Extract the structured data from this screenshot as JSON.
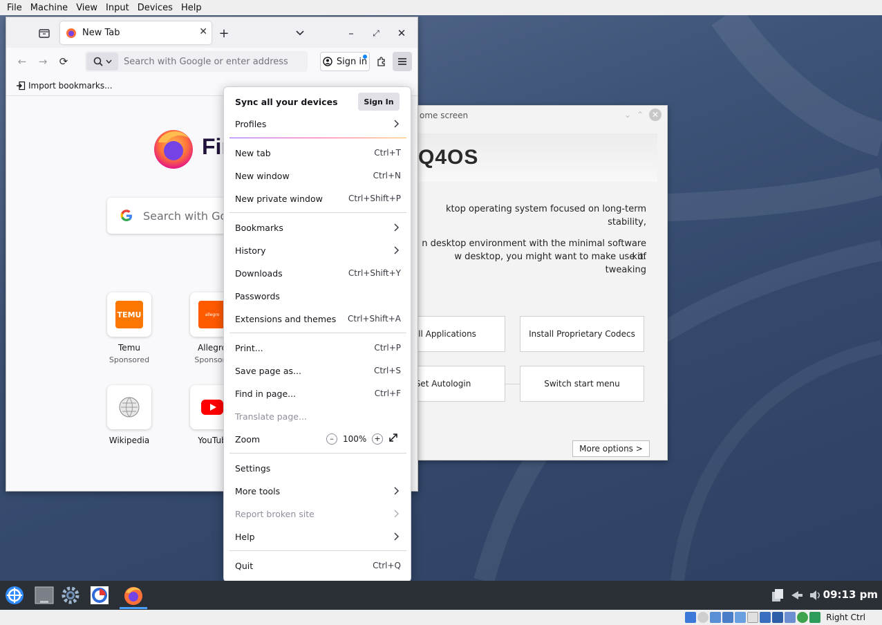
{
  "host_menu": [
    "File",
    "Machine",
    "View",
    "Input",
    "Devices",
    "Help"
  ],
  "firefox": {
    "tab_title": "New Tab",
    "url_placeholder": "Search with Google or enter address",
    "sign_in": "Sign in",
    "import_bookmarks": "Import bookmarks...",
    "wordmark": "Fir",
    "search_placeholder": "Search with Goog",
    "shortcuts": [
      {
        "label": "Temu",
        "sub": "Sponsored",
        "tile_text": "TEMU"
      },
      {
        "label": "Allegro",
        "sub": "Sponsore",
        "tile_text": "allegro"
      },
      {
        "label": "Wikipedia",
        "sub": ""
      },
      {
        "label": "YouTub",
        "sub": ""
      }
    ]
  },
  "app_menu": {
    "sync_title": "Sync all your devices",
    "sync_button": "Sign In",
    "profiles": "Profiles",
    "items": [
      {
        "label": "New tab",
        "shortcut": "Ctrl+T"
      },
      {
        "label": "New window",
        "shortcut": "Ctrl+N"
      },
      {
        "label": "New private window",
        "shortcut": "Ctrl+Shift+P"
      },
      {
        "label": "Bookmarks",
        "shortcut": ""
      },
      {
        "label": "History",
        "shortcut": ""
      },
      {
        "label": "Downloads",
        "shortcut": "Ctrl+Shift+Y"
      },
      {
        "label": "Passwords",
        "shortcut": ""
      },
      {
        "label": "Extensions and themes",
        "shortcut": "Ctrl+Shift+A"
      },
      {
        "label": "Print...",
        "shortcut": "Ctrl+P"
      },
      {
        "label": "Save page as...",
        "shortcut": "Ctrl+S"
      },
      {
        "label": "Find in page...",
        "shortcut": "Ctrl+F"
      },
      {
        "label": "Translate page...",
        "shortcut": ""
      },
      {
        "label": "Zoom",
        "shortcut": ""
      },
      {
        "label": "Settings",
        "shortcut": ""
      },
      {
        "label": "More tools",
        "shortcut": ""
      },
      {
        "label": "Report broken site",
        "shortcut": ""
      },
      {
        "label": "Help",
        "shortcut": ""
      },
      {
        "label": "Quit",
        "shortcut": "Ctrl+Q"
      }
    ],
    "zoom_value": "100%"
  },
  "welcome": {
    "title": "ome screen",
    "brand": "Q4OS",
    "text1": "ktop operating system focused on long-term stability,",
    "text2": "n desktop environment with the minimal software kit.",
    "text3": "w desktop, you might want to make use of tweaking",
    "buttons": [
      "tall Applications",
      "Install Proprietary Codecs",
      "Set Autologin",
      "Switch start menu"
    ],
    "more_options": "More options >"
  },
  "taskbar": {
    "clock": "09:13 pm"
  },
  "vbox_status": {
    "right_ctrl": "Right Ctrl"
  }
}
